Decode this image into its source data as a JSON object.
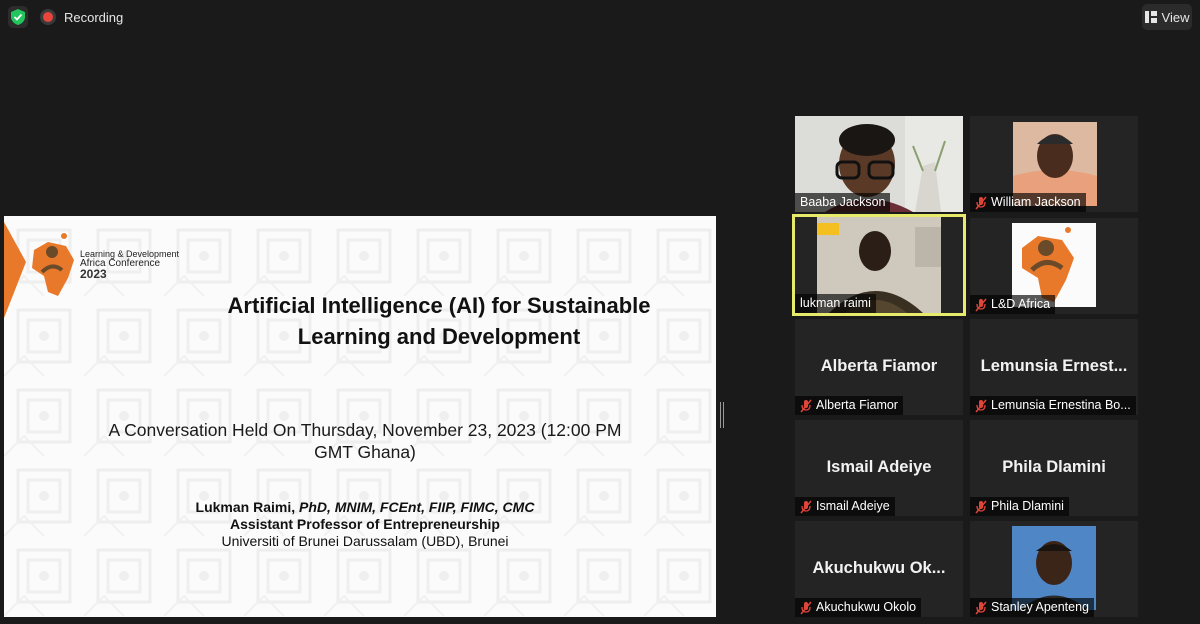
{
  "topbar": {
    "recording_label": "Recording",
    "view_label": "View"
  },
  "slide": {
    "logo_text_line1": "Learning & Development",
    "logo_text_line2": "Africa Conference",
    "logo_year": "2023",
    "title_line1": "Artificial Intelligence (AI) for Sustainable",
    "title_line2": "Learning and Development",
    "subtitle_line1": "A Conversation Held On Thursday, November 23, 2023 (12:00 PM",
    "subtitle_line2": "GMT Ghana)",
    "author_name": "Lukman Raimi,",
    "author_credentials": " PhD, MNIM, FCEnt, FIIP, FIMC, CMC",
    "author_title": "Assistant Professor of Entrepreneurship",
    "author_affiliation": "Universiti of Brunei Darussalam (UBD), Brunei"
  },
  "participants": [
    {
      "name": "Baaba Jackson",
      "muted": false
    },
    {
      "name": "William Jackson",
      "muted": true
    },
    {
      "name": "lukman raimi",
      "muted": false,
      "active_speaker": true
    },
    {
      "name": "L&D Africa",
      "muted": true
    },
    {
      "name": "Alberta Fiamor",
      "display": "Alberta Fiamor",
      "muted": true
    },
    {
      "name": "Lemunsia Ernestina Bo...",
      "display": "Lemunsia  Ernest...",
      "muted": true
    },
    {
      "name": "Ismail Adeiye",
      "display": "Ismail Adeiye",
      "muted": true
    },
    {
      "name": "Phila Dlamini",
      "display": "Phila Dlamini",
      "muted": true
    },
    {
      "name": "Akuchukwu Okolo",
      "display": "Akuchukwu  Ok...",
      "muted": true
    },
    {
      "name": "Stanley Apenteng",
      "muted": true
    }
  ],
  "colors": {
    "accent_orange": "#e8792b",
    "active_border": "#e8ea6b",
    "mute_red": "#e0453a",
    "shield_green": "#23c55e"
  }
}
